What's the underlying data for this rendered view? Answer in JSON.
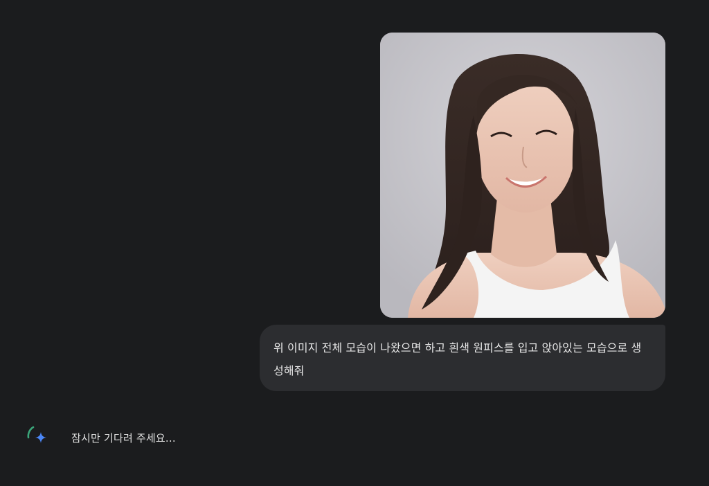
{
  "conversation": {
    "user_image": {
      "icon": "uploaded-portrait-photo",
      "background_color": "#c9c8cd"
    },
    "user_message": {
      "text": "위 이미지 전체 모습이 나왔으면 하고 흰색 원피스를 입고 앉아있는 모습으로 생성해줘"
    },
    "assistant": {
      "status_text": "잠시만 기다려 주세요...",
      "icon": "gemini-sparkle-icon",
      "spinner_color": "#3ba57a",
      "sparkle_color": "#4b86f5"
    }
  }
}
